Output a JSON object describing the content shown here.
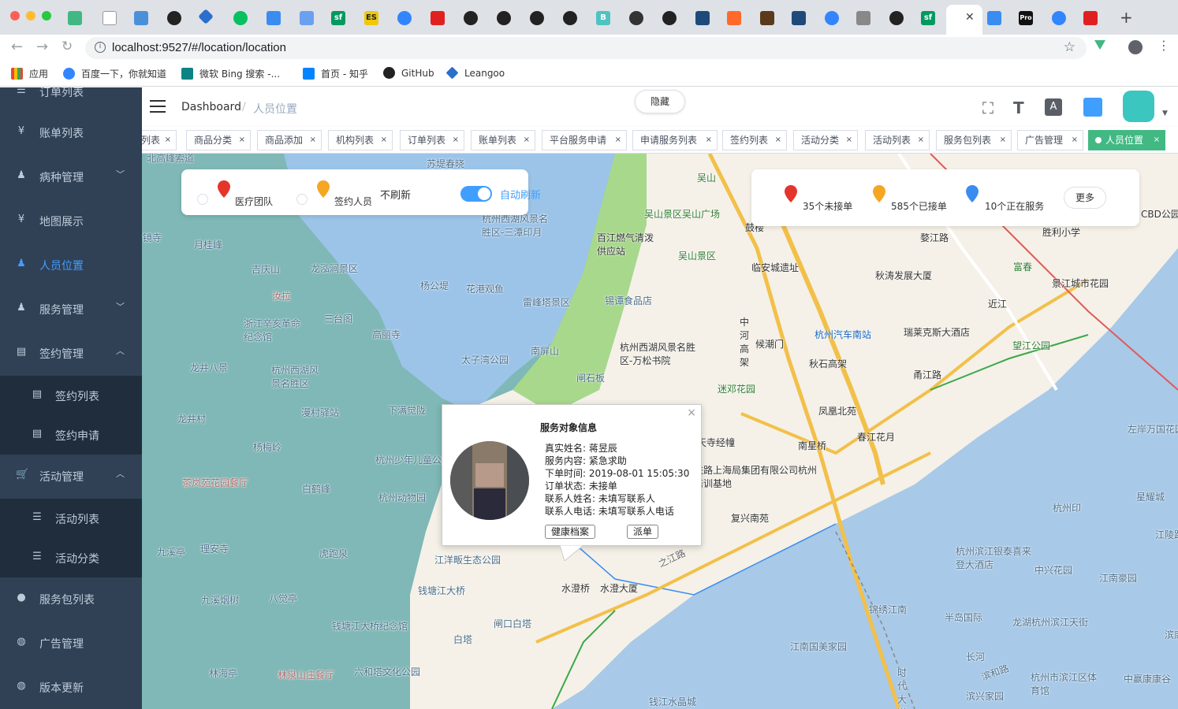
{
  "browser": {
    "url": "localhost:9527/#/location/location",
    "bookmarks": [
      "应用",
      "百度一下，你就知道",
      "微软 Bing 搜索 -...",
      "首页 - 知乎",
      "GitHub",
      "Leangoo"
    ],
    "tab_badges": [
      "sf",
      "ES",
      "sf",
      "B",
      "Pro"
    ]
  },
  "sidebar": {
    "items": [
      {
        "label": "订单列表",
        "icon": "list-icon"
      },
      {
        "label": "账单列表",
        "icon": "yen-icon"
      },
      {
        "label": "病种管理",
        "icon": "user-icon"
      },
      {
        "label": "地图展示",
        "icon": "yen-icon"
      },
      {
        "label": "人员位置",
        "icon": "user-icon"
      },
      {
        "label": "服务管理",
        "icon": "user-icon"
      },
      {
        "label": "签约管理",
        "icon": "doc-icon"
      },
      {
        "label": "签约列表",
        "icon": "doc-icon"
      },
      {
        "label": "签约申请",
        "icon": "doc-icon"
      },
      {
        "label": "活动管理",
        "icon": "cart-icon"
      },
      {
        "label": "活动列表",
        "icon": "list-icon"
      },
      {
        "label": "活动分类",
        "icon": "list-icon"
      },
      {
        "label": "服务包列表",
        "icon": "person-icon"
      },
      {
        "label": "广告管理",
        "icon": "globe-icon"
      },
      {
        "label": "版本更新",
        "icon": "globe-icon"
      }
    ]
  },
  "navbar": {
    "breadcrumb": [
      "Dashboard",
      "人员位置"
    ],
    "hide_button": "隐藏"
  },
  "tags": [
    "列表",
    "商品分类",
    "商品添加",
    "机构列表",
    "订单列表",
    "账单列表",
    "平台服务申请",
    "申请服务列表",
    "签约列表",
    "活动分类",
    "活动列表",
    "服务包列表",
    "广告管理",
    "人员位置"
  ],
  "filter_panel": {
    "medical_team": "医疗团队",
    "signed_staff": "签约人员",
    "no_refresh": "不刷新",
    "auto_refresh": "自动刷新",
    "auto_refresh_on": true
  },
  "stats_panel": {
    "not_accepted": "35个未接单",
    "accepted": "585个已接单",
    "in_service": "10个正在服务",
    "more": "更多"
  },
  "popup": {
    "title": "服务对象信息",
    "close": "×",
    "rows": [
      {
        "label": "真实姓名:",
        "value": "蒋昱辰"
      },
      {
        "label": "服务内容:",
        "value": "紧急求助"
      },
      {
        "label": "下单时间:",
        "value": "2019-08-01 15:05:30"
      },
      {
        "label": "订单状态:",
        "value": "未接单"
      },
      {
        "label": "联系人姓名:",
        "value": "未填写联系人"
      },
      {
        "label": "联系人电话:",
        "value": "未填写联系人电话"
      }
    ],
    "health_button": "健康档案",
    "dispatch_button": "派单"
  },
  "map_labels": {
    "water": [
      "北高峰索道",
      "月桂峰",
      "吉庆山",
      "龙泓涧景区",
      "杨公堤",
      "花港观鱼",
      "雷峰塔景区",
      "三台阁",
      "高丽寺",
      "汝拉",
      "浙江辛亥革命纪念馆",
      "龙井八景",
      "杭州西湖风景名胜区",
      "龙井村",
      "漫村驿站",
      "下满觉陇",
      "杨梅岭",
      "茶岚苑花园餐厅",
      "白鹤峰",
      "九溪亭",
      "理安寺",
      "虎跑泉",
      "九溪烟树",
      "八觉亭",
      "林海亭",
      "林泉山庄餐厅",
      "六和塔文化公园",
      "苏堤春晓",
      "杭州西湖风景名胜区-三潭印月",
      "锡谭食品店",
      "太子湾公园",
      "南屏山",
      "闸石板",
      "杭州少年儿童公园",
      "杭州动物园",
      "钱塘江大桥纪念馆",
      "钱塘江大桥",
      "江洋畈生态公园",
      "闸口白塔",
      "白塔",
      "钱江水晶城",
      "镜寺"
    ],
    "land": [
      "吴山",
      "吴山景区吴山广场",
      "鼓楼",
      "百江燃气清泼供应站",
      "吴山景区",
      "临安城遗址",
      "杭州西湖风景名胜区-万松书院",
      "迷邓花园",
      "天寺经幢",
      "中河高架",
      "候潮门",
      "杭州汽车南站",
      "秋石高架",
      "瑞莱克斯大酒店",
      "甬江路",
      "秋涛发展大厦",
      "婺江路",
      "近江",
      "望江公园",
      "富春",
      "景江城市花园",
      "胜利小学",
      "CBD公园",
      "凤凰北苑",
      "春江花月",
      "南星桥",
      "复兴南苑",
      "中国铁路上海局集团有限公司杭州职工培训基地",
      "水澄桥",
      "水澄大厦",
      "之江路"
    ],
    "river": [
      "左岸万国花园",
      "星耀城",
      "杭州印",
      "江陵路",
      "杭州滨江银泰喜来登大酒店",
      "中兴花园",
      "江南豪园",
      "锦绣江南",
      "半岛国际",
      "龙湖杭州滨江天街",
      "江南国美家园",
      "长河",
      "滨兴家园",
      "杭州市滨江区体育馆",
      "中赢康康谷",
      "滨和路",
      "时代大道",
      "滨康"
    ]
  },
  "colors": {
    "sidebar_bg": "#304156",
    "active_blue": "#409eff",
    "tag_active": "#42b983",
    "pin_red": "#e5352b",
    "pin_orange": "#f5a623",
    "pin_blue": "#3b8cf0"
  }
}
